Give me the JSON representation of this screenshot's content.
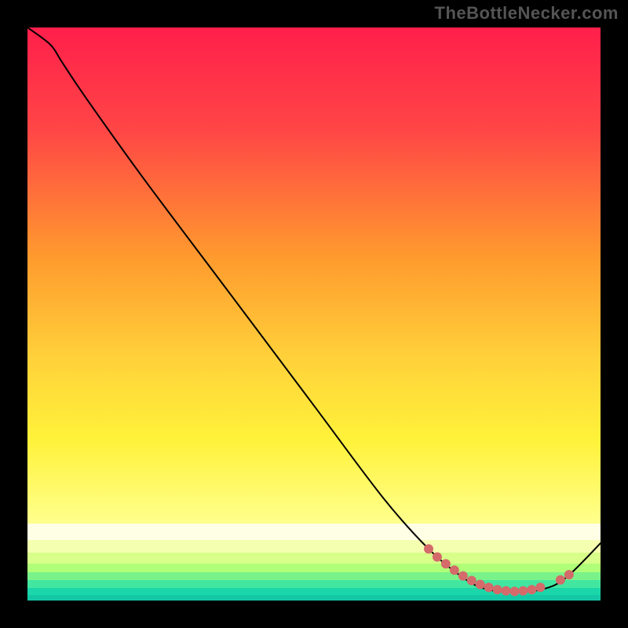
{
  "watermark": "TheBottleNecker.com",
  "chart_data": {
    "type": "line",
    "title": "",
    "xlabel": "",
    "ylabel": "",
    "xlim": [
      0,
      100
    ],
    "ylim": [
      0,
      100
    ],
    "gradient_stops": [
      {
        "pct": 0,
        "color": "#ff1f4b"
      },
      {
        "pct": 18,
        "color": "#ff4646"
      },
      {
        "pct": 40,
        "color": "#ff9a2e"
      },
      {
        "pct": 58,
        "color": "#ffd23a"
      },
      {
        "pct": 72,
        "color": "#fff23a"
      },
      {
        "pct": 86,
        "color": "#ffff8a"
      },
      {
        "pct": 100,
        "color": "#ffffd8"
      }
    ],
    "bottom_bands": [
      {
        "color": "#ffffe6",
        "height_pct": 3.0
      },
      {
        "color": "#f4ffb0",
        "height_pct": 2.2
      },
      {
        "color": "#d8ff8a",
        "height_pct": 1.8
      },
      {
        "color": "#b0ff78",
        "height_pct": 1.6
      },
      {
        "color": "#7af28a",
        "height_pct": 1.4
      },
      {
        "color": "#42e6a0",
        "height_pct": 1.3
      },
      {
        "color": "#1ad6a8",
        "height_pct": 1.2
      },
      {
        "color": "#14c8a6",
        "height_pct": 1.0
      }
    ],
    "series": [
      {
        "name": "bottleneck-curve",
        "points": [
          {
            "x": 0,
            "y": 100
          },
          {
            "x": 4,
            "y": 97
          },
          {
            "x": 6,
            "y": 94
          },
          {
            "x": 10,
            "y": 88
          },
          {
            "x": 20,
            "y": 74
          },
          {
            "x": 35,
            "y": 54
          },
          {
            "x": 50,
            "y": 34
          },
          {
            "x": 62,
            "y": 18
          },
          {
            "x": 70,
            "y": 9
          },
          {
            "x": 76,
            "y": 4
          },
          {
            "x": 80,
            "y": 2
          },
          {
            "x": 85,
            "y": 1.5
          },
          {
            "x": 90,
            "y": 2
          },
          {
            "x": 94,
            "y": 4
          },
          {
            "x": 100,
            "y": 10
          }
        ]
      }
    ],
    "highlight_dots": [
      {
        "x": 70.0,
        "y": 9.0
      },
      {
        "x": 71.5,
        "y": 7.6
      },
      {
        "x": 73.0,
        "y": 6.4
      },
      {
        "x": 74.5,
        "y": 5.3
      },
      {
        "x": 76.0,
        "y": 4.3
      },
      {
        "x": 77.5,
        "y": 3.5
      },
      {
        "x": 79.0,
        "y": 2.8
      },
      {
        "x": 80.5,
        "y": 2.3
      },
      {
        "x": 82.0,
        "y": 1.9
      },
      {
        "x": 83.5,
        "y": 1.7
      },
      {
        "x": 85.0,
        "y": 1.6
      },
      {
        "x": 86.5,
        "y": 1.7
      },
      {
        "x": 88.0,
        "y": 1.9
      },
      {
        "x": 89.5,
        "y": 2.3
      },
      {
        "x": 93.0,
        "y": 3.6
      },
      {
        "x": 94.5,
        "y": 4.5
      }
    ],
    "dot_radius_px": 6
  }
}
